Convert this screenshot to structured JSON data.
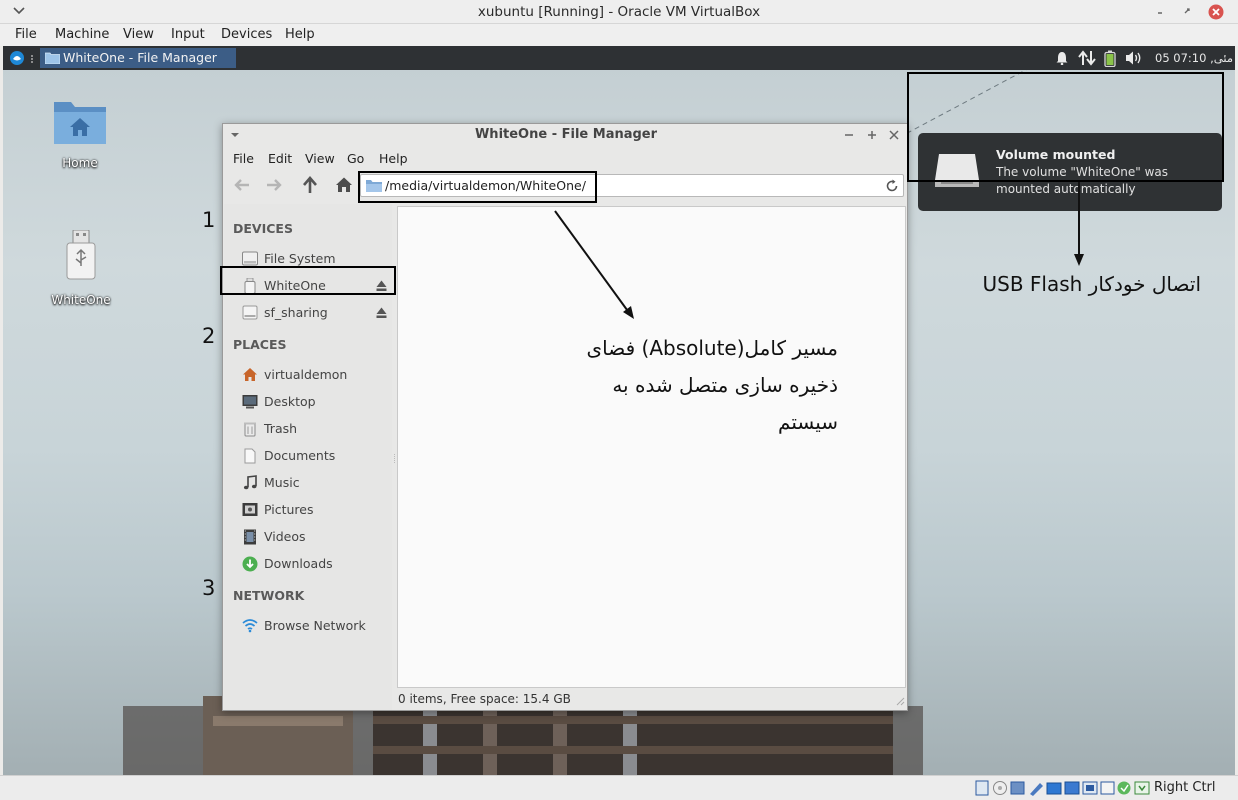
{
  "host_window": {
    "title": "xubuntu [Running] - Oracle VM VirtualBox",
    "menu": [
      "File",
      "Machine",
      "View",
      "Input",
      "Devices",
      "Help"
    ],
    "host_key": "Right Ctrl"
  },
  "panel": {
    "taskbar_label": "WhiteOne - File Manager",
    "clock": "05 مئی, 07:10"
  },
  "desktop": {
    "icons": [
      {
        "label": "Home",
        "icon": "folder-home-icon"
      },
      {
        "label": "WhiteOne",
        "icon": "usb-drive-icon"
      }
    ]
  },
  "file_manager": {
    "title": "WhiteOne - File Manager",
    "menu": [
      "File",
      "Edit",
      "View",
      "Go",
      "Help"
    ],
    "address": "/media/virtualdemon/WhiteOne/",
    "sections": [
      {
        "heading": "DEVICES",
        "items": [
          {
            "label": "File System",
            "icon": "harddisk-icon"
          },
          {
            "label": "WhiteOne",
            "icon": "usb-drive-icon",
            "eject": true,
            "selected": true
          },
          {
            "label": "sf_sharing",
            "icon": "drive-icon",
            "eject": true
          }
        ]
      },
      {
        "heading": "PLACES",
        "items": [
          {
            "label": "virtualdemon",
            "icon": "home-icon"
          },
          {
            "label": "Desktop",
            "icon": "desktop-icon"
          },
          {
            "label": "Trash",
            "icon": "trash-icon"
          },
          {
            "label": "Documents",
            "icon": "document-icon"
          },
          {
            "label": "Music",
            "icon": "music-icon"
          },
          {
            "label": "Pictures",
            "icon": "pictures-icon"
          },
          {
            "label": "Videos",
            "icon": "videos-icon"
          },
          {
            "label": "Downloads",
            "icon": "downloads-icon"
          }
        ]
      },
      {
        "heading": "NETWORK",
        "items": [
          {
            "label": "Browse Network",
            "icon": "network-icon"
          }
        ]
      }
    ],
    "status": "0 items, Free space: 15.4 GB"
  },
  "notification": {
    "title": "Volume mounted",
    "body": "The volume \"WhiteOne\" was mounted automatically"
  },
  "annotations": {
    "numbers": [
      "1",
      "2",
      "3"
    ],
    "path_note_lines": [
      "مسیر کامل(Absolute) فضای",
      "ذخیره سازی متصل شده به",
      "سیستم"
    ],
    "usb_note": "اتصال خودکار USB Flash"
  },
  "colors": {
    "panel": "#2e3134",
    "taskbar_active": "#3c5d86",
    "notification_bg": "#2f3234",
    "close_button": "#d9534f"
  }
}
